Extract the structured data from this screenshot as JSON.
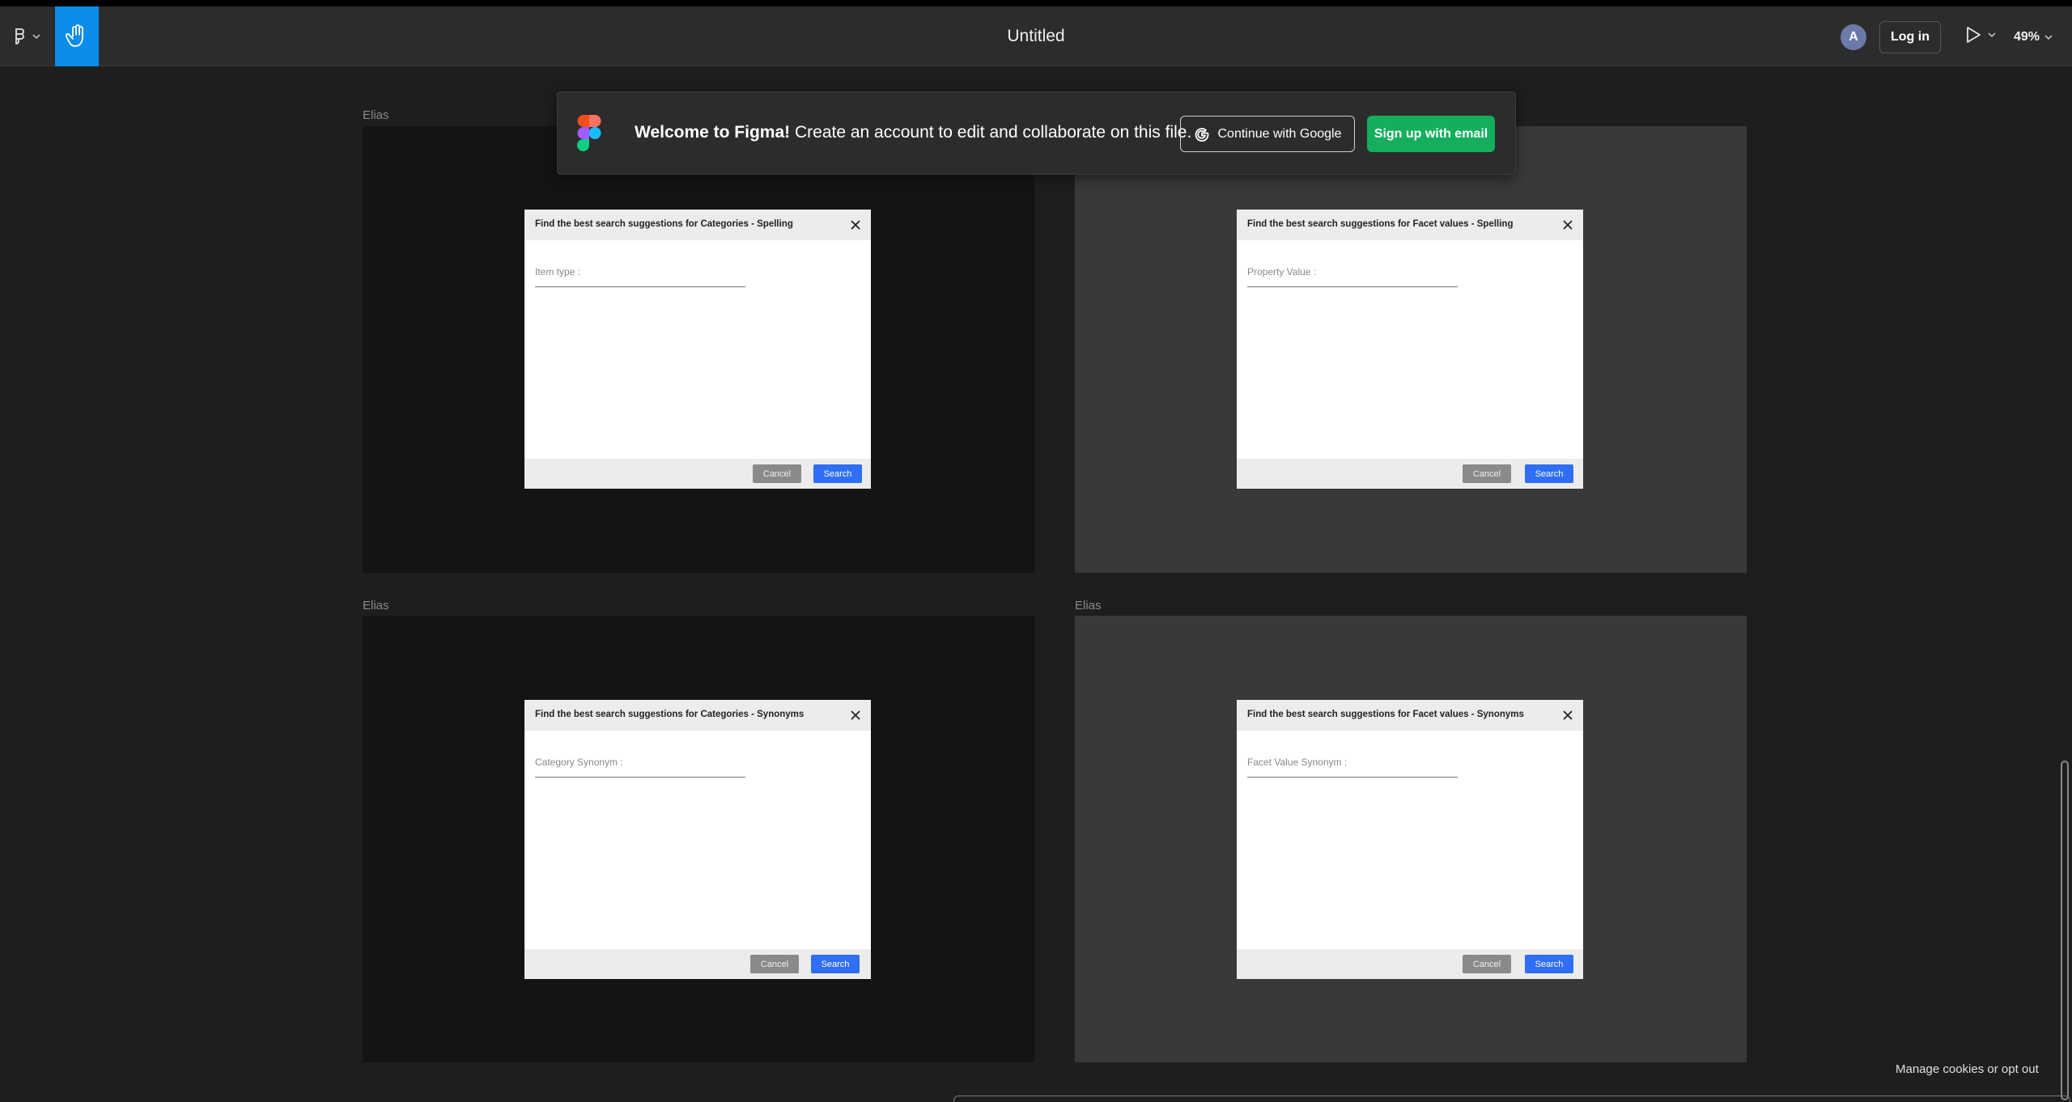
{
  "toolbar": {
    "title": "Untitled",
    "avatar_letter": "A",
    "login_label": "Log in",
    "zoom": "49%",
    "accent": "#0c8ce9"
  },
  "banner": {
    "welcome_bold": "Welcome to Figma!",
    "welcome_text": " Create an account to edit and collaborate on this file.",
    "google_button": "Continue with Google",
    "email_button": "Sign up with email",
    "email_button_color": "#14ae5c"
  },
  "frames": [
    {
      "label": "Elias",
      "dialog": {
        "title": "Find the best search suggestions for Categories - Spelling",
        "field": "Item type :",
        "cancel": "Cancel",
        "search": "Search"
      }
    },
    {
      "label": "",
      "dialog": {
        "title": "Find the best search suggestions for Facet values - Spelling",
        "field": "Property Value :",
        "cancel": "Cancel",
        "search": "Search"
      }
    },
    {
      "label": "Elias",
      "dialog": {
        "title": "Find the best search suggestions for Categories - Synonyms",
        "field": "Category Synonym :",
        "cancel": "Cancel",
        "search": "Search"
      }
    },
    {
      "label": "Elias",
      "dialog": {
        "title": "Find the best search suggestions for Facet values  - Synonyms",
        "field": "Facet Value Synonym :",
        "cancel": "Cancel",
        "search": "Search"
      }
    }
  ],
  "footer": {
    "cookies_link": "Manage cookies or opt out"
  }
}
